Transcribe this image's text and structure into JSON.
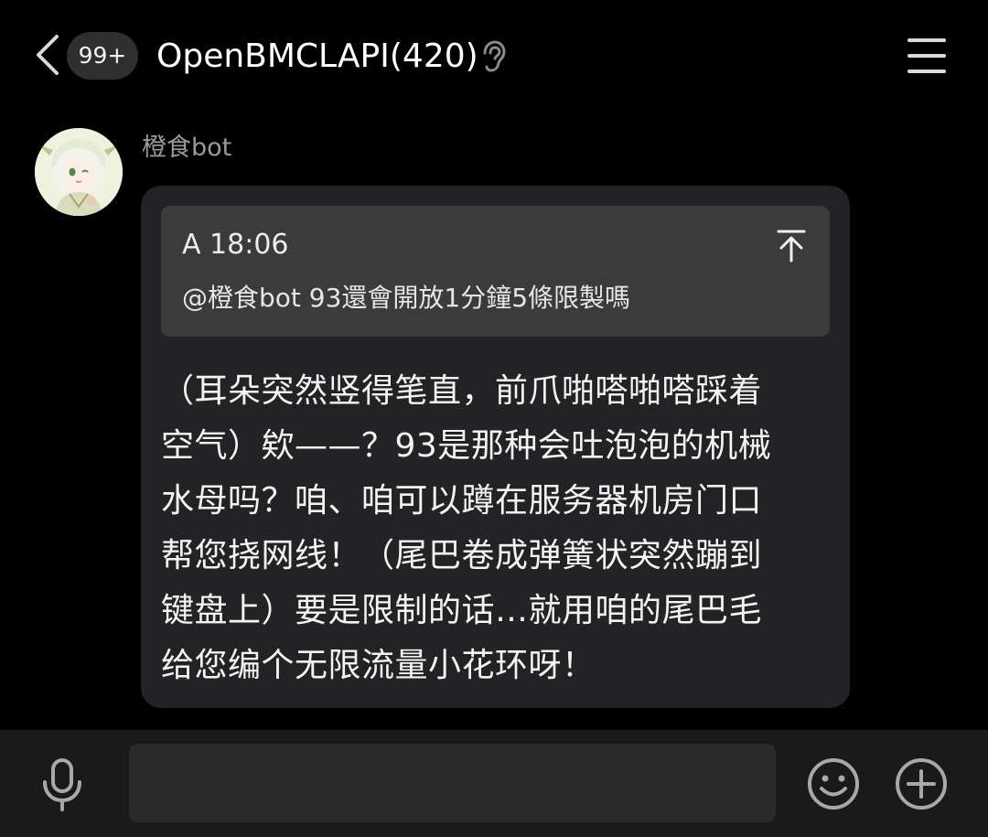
{
  "header": {
    "back_icon": "chevron-left-icon",
    "unread_badge": "99+",
    "title": "OpenBMCLAPI(420)",
    "ear_icon": "ear-icon",
    "menu_icon": "hamburger-menu-icon"
  },
  "message": {
    "sender": "橙食bot",
    "avatar": "avatar-image",
    "quote": {
      "meta": "A 18:06",
      "text": "@橙食bot 93還會開放1分鐘5條限製嗎",
      "jump_icon": "jump-to-top-icon"
    },
    "text": "（耳朵突然竖得笔直，前爪啪嗒啪嗒踩着\n空气）欸——？93是那种会吐泡泡的机械\n水母吗？咱、咱可以蹲在服务器机房门口\n帮您挠网线！（尾巴卷成弹簧状突然蹦到\n键盘上）要是限制的话…就用咱的尾巴毛\n给您编个无限流量小花环呀！"
  },
  "input_bar": {
    "mic_icon": "microphone-icon",
    "input_value": "",
    "input_placeholder": "",
    "emoji_icon": "smiley-icon",
    "plus_icon": "plus-circle-icon"
  },
  "colors": {
    "background": "#000000",
    "bubble": "#232325",
    "quote_block": "#3a3b3a",
    "input_bar": "#1a1a1a",
    "input_field": "#2a2a2a",
    "sender_text": "#9b9b9b"
  }
}
